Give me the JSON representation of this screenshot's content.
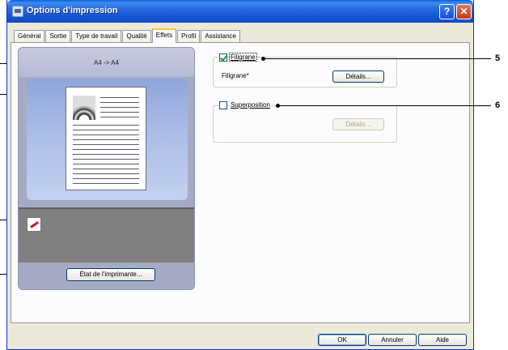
{
  "window": {
    "title": "Options d'impression",
    "help_glyph": "?",
    "close_glyph": "✕"
  },
  "tabs": [
    {
      "label": "Général"
    },
    {
      "label": "Sortie"
    },
    {
      "label": "Type de travail"
    },
    {
      "label": "Qualité"
    },
    {
      "label": "Effets"
    },
    {
      "label": "Profil"
    },
    {
      "label": "Assistance"
    }
  ],
  "active_tab": "Effets",
  "preview": {
    "paper_size": "A4 -> A4",
    "printer_status_button": "État de l'imprimante..."
  },
  "watermark": {
    "checkbox_label": "Filigrane",
    "checked": true,
    "value_label": "Filigrane*",
    "details_button": "Détails..."
  },
  "overlay": {
    "checkbox_label": "Superposition",
    "checked": false,
    "details_button": "Détails..."
  },
  "footer": {
    "ok": "OK",
    "cancel": "Annuler",
    "help": "Aide"
  },
  "callouts": {
    "right_1": "5",
    "right_2": "6"
  },
  "colors": {
    "titlebar": "#1456d2",
    "dialog_bg": "#ece9d8",
    "active_tab_accent": "#ffc83c"
  }
}
